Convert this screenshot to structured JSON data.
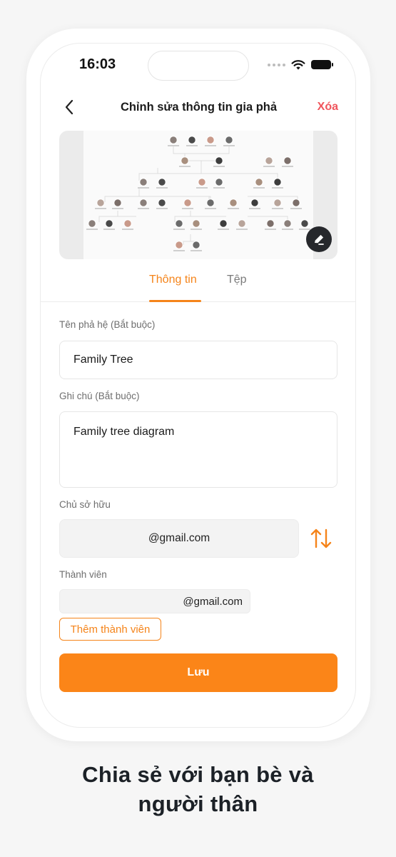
{
  "status_bar": {
    "time": "16:03"
  },
  "nav": {
    "title": "Chỉnh sửa thông tin gia phả",
    "delete_label": "Xóa"
  },
  "tabs": [
    {
      "label": "Thông tin",
      "active": true
    },
    {
      "label": "Tệp",
      "active": false
    }
  ],
  "form": {
    "name_label": "Tên phả hệ (Bắt buộc)",
    "name_value": "Family Tree",
    "note_label": "Ghi chú (Bắt buộc)",
    "note_value": "Family tree diagram",
    "owner_label": "Chủ sở hữu",
    "owner_value": "@gmail.com",
    "members_label": "Thành viên",
    "members": [
      "@gmail.com"
    ],
    "add_member_label": "Thêm thành viên",
    "save_label": "Lưu"
  },
  "caption": {
    "line1": "Chia sẻ với bạn bè và",
    "line2": "người thân"
  },
  "colors": {
    "accent": "#fb8518",
    "delete": "#f0555c",
    "text": "#1b1b1b"
  },
  "icons": [
    "back-arrow-icon",
    "wifi-icon",
    "battery-icon",
    "edit-icon",
    "swap-icon"
  ]
}
